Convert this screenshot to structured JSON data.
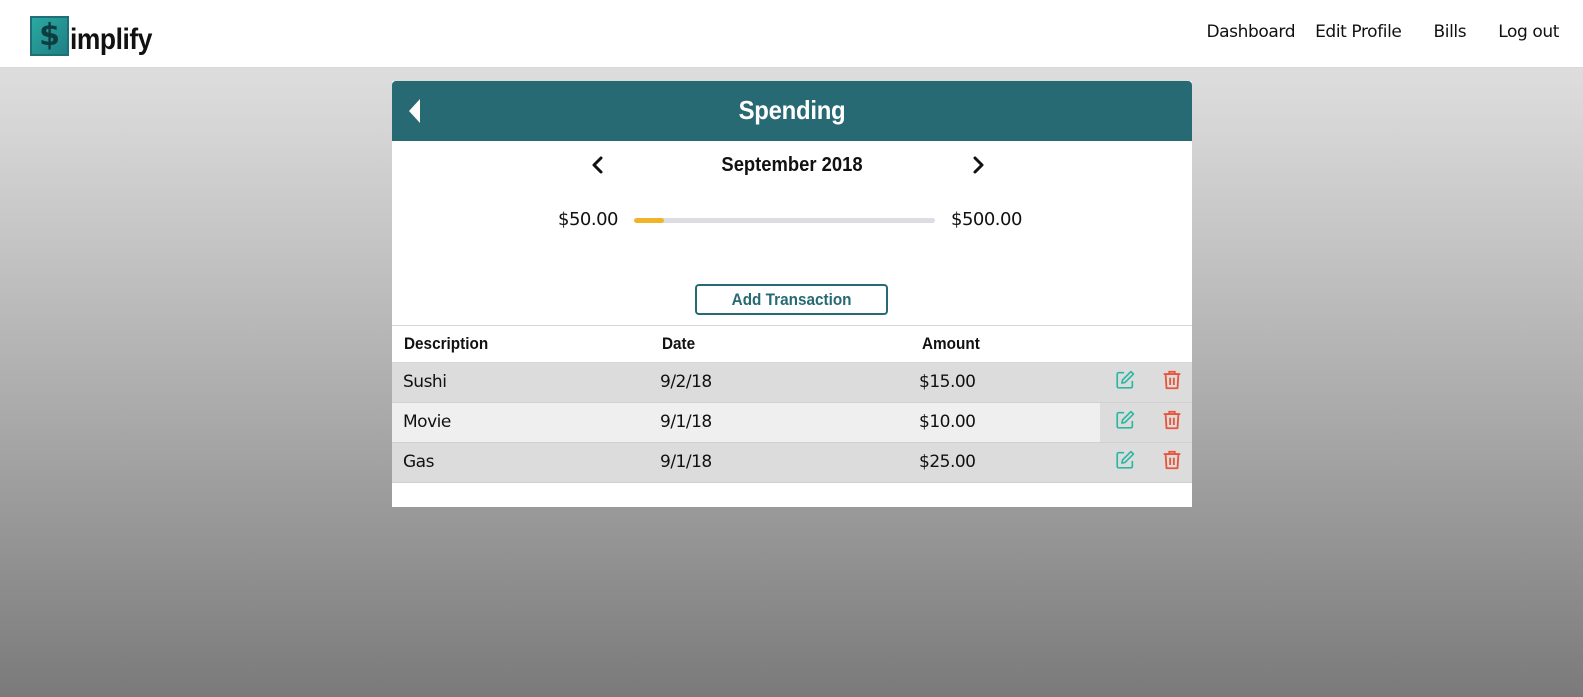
{
  "app": {
    "logo_letter": "$",
    "logo_text": "implify"
  },
  "nav": {
    "items": [
      {
        "label": "Dashboard"
      },
      {
        "label": "Edit Profile"
      },
      {
        "label": "Bills"
      },
      {
        "label": "Log out"
      }
    ]
  },
  "page": {
    "title": "Spending",
    "month": "September 2018",
    "budget": {
      "spent": "$50.00",
      "total": "$500.00",
      "progress_fraction": 0.1
    },
    "add_button_label": "Add Transaction"
  },
  "table": {
    "headers": [
      "Description",
      "Date",
      "Amount"
    ],
    "rows": [
      {
        "description": "Sushi",
        "date": "9/2/18",
        "amount": "$15.00"
      },
      {
        "description": "Movie",
        "date": "9/1/18",
        "amount": "$10.00"
      },
      {
        "description": "Gas",
        "date": "9/1/18",
        "amount": "$25.00"
      }
    ]
  },
  "colors": {
    "header_teal": "#276a74",
    "progress_fill": "#f0b429",
    "edit_icon": "#2bb8a3",
    "delete_icon": "#e8553a"
  },
  "icons": {
    "back": "caret-left-icon",
    "prev_month": "chevron-left-icon",
    "next_month": "chevron-right-icon",
    "edit": "edit-icon",
    "delete": "trash-icon"
  }
}
